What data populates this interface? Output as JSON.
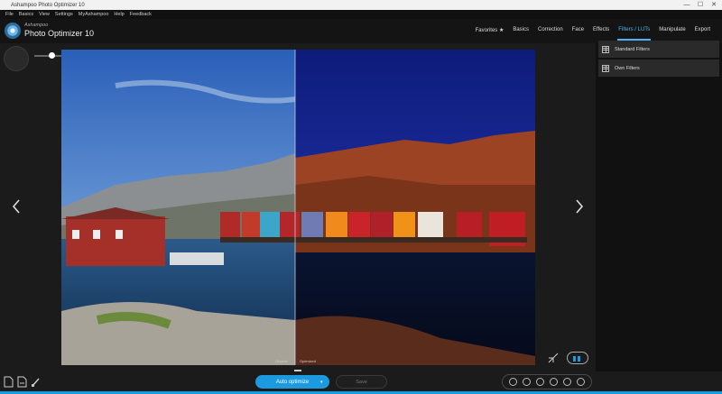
{
  "window": {
    "title": "Ashampoo Photo Optimizer 10",
    "controls": [
      "—",
      "☐",
      "✕"
    ]
  },
  "menu": [
    "File",
    "Basics",
    "View",
    "Settings",
    "MyAshampoo",
    "Help",
    "Feedback"
  ],
  "brand": {
    "small": "Ashampoo",
    "big": "Photo Optimizer 10"
  },
  "nav": [
    {
      "label": "Favorites ★",
      "active": false
    },
    {
      "label": "Basics",
      "active": false
    },
    {
      "label": "Correction",
      "active": false
    },
    {
      "label": "Face",
      "active": false
    },
    {
      "label": "Effects",
      "active": false
    },
    {
      "label": "Filters / LUTs",
      "active": true
    },
    {
      "label": "Manipulate",
      "active": false
    },
    {
      "label": "Export",
      "active": false
    }
  ],
  "panel": {
    "items": [
      "Standard Filters",
      "Own Filters"
    ]
  },
  "viewer": {
    "before_label": "Original",
    "after_label": "Optimized"
  },
  "buttons": {
    "auto_optimize": "Auto optimize",
    "save": "Save"
  },
  "colors": {
    "accent": "#1c9ae0",
    "active_tab": "#4fb2ee"
  },
  "icons": {
    "left_arrow": "chevron-left-icon",
    "right_arrow": "chevron-right-icon",
    "compare": "compare-icon",
    "tools": [
      "wand-icon",
      "undo-icon",
      "redo-icon",
      "rotate-left-icon",
      "rotate-right-icon",
      "settings-icon"
    ]
  }
}
